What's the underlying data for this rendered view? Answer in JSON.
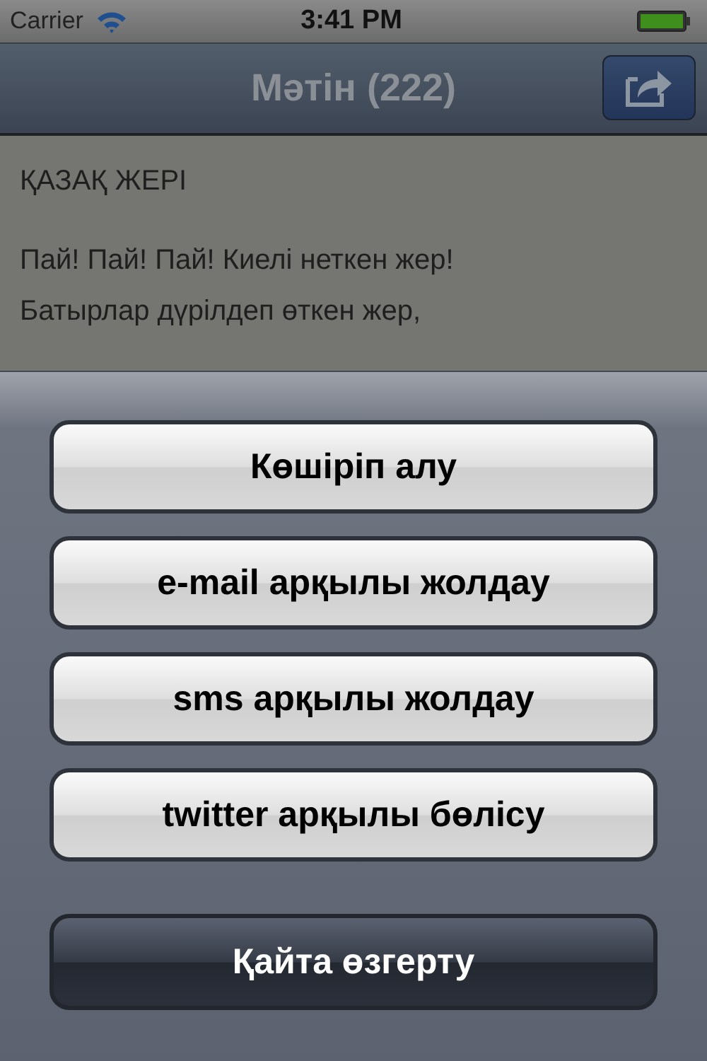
{
  "status_bar": {
    "carrier": "Carrier",
    "time": "3:41 PM"
  },
  "nav_bar": {
    "title": "Мәтін (222)"
  },
  "text_view": {
    "heading": "ҚАЗАҚ ЖЕРІ",
    "lines": [
      "Пай! Пай! Пай! Киелі неткен жер!",
      "Батырлар дүрілдеп өткен жер,"
    ]
  },
  "action_sheet": {
    "buttons": [
      {
        "label": "Көшіріп алу",
        "kind": "default"
      },
      {
        "label": "e-mail арқылы жолдау",
        "kind": "default"
      },
      {
        "label": "sms арқылы жолдау",
        "kind": "default"
      },
      {
        "label": "twitter арқылы бөлісу",
        "kind": "default"
      },
      {
        "label": "Қайта өзгерту",
        "kind": "cancel"
      }
    ]
  }
}
